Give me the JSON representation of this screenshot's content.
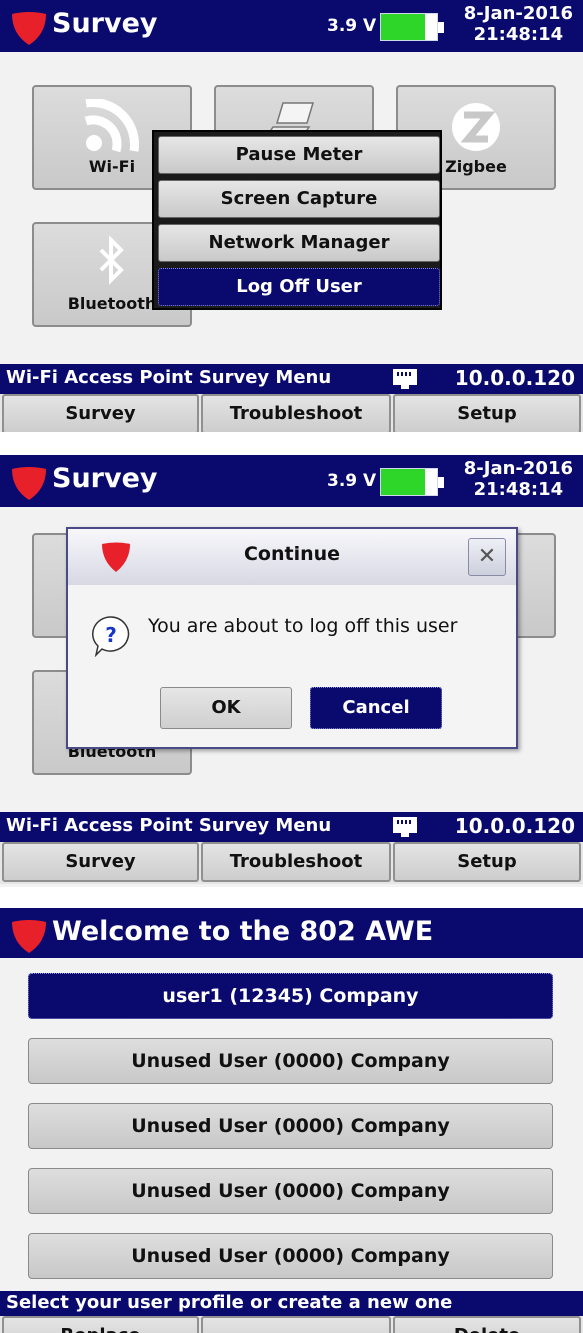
{
  "colors": {
    "title_bar": "#0a0a6e",
    "battery_fill": "#2fd62a",
    "selected": "#0a0a6e",
    "logo_red": "#e8202a"
  },
  "header": {
    "title": "Survey",
    "voltage": "3.9 V",
    "battery_level": 0.78,
    "date": "8-Jan-2016",
    "time": "21:48:14"
  },
  "tiles": [
    {
      "label": "Wi-Fi",
      "icon": "wifi-icon"
    },
    {
      "label": "",
      "icon": "laptop-icon"
    },
    {
      "label": "Zigbee",
      "icon": "zigbee-icon"
    },
    {
      "label": "Bluetooth",
      "icon": "bluetooth-icon"
    }
  ],
  "popup_menu": {
    "items": [
      {
        "label": "Pause Meter"
      },
      {
        "label": "Screen Capture"
      },
      {
        "label": "Network Manager"
      },
      {
        "label": "Log Off User",
        "selected": true
      }
    ]
  },
  "status_bar": {
    "text": "Wi-Fi Access Point Survey Menu",
    "ip": "10.0.0.120",
    "icon": "ethernet-icon"
  },
  "tabs": [
    {
      "label": "Survey"
    },
    {
      "label": "Troubleshoot"
    },
    {
      "label": "Setup"
    }
  ],
  "dialog": {
    "title": "Continue",
    "message": "You are about to log off this user",
    "ok_label": "OK",
    "cancel_label": "Cancel",
    "close_label": "✕",
    "icon": "question-icon"
  },
  "welcome": {
    "title": "Welcome to the 802 AWE",
    "users": [
      {
        "label": "user1 (12345) Company",
        "selected": true
      },
      {
        "label": "Unused User (0000) Company"
      },
      {
        "label": "Unused User (0000) Company"
      },
      {
        "label": "Unused User (0000) Company"
      },
      {
        "label": "Unused User (0000) Company"
      }
    ],
    "status": "Select your user profile or create a new one",
    "buttons": [
      {
        "label": "Replace"
      },
      {
        "label": ""
      },
      {
        "label": "Delete"
      }
    ]
  }
}
